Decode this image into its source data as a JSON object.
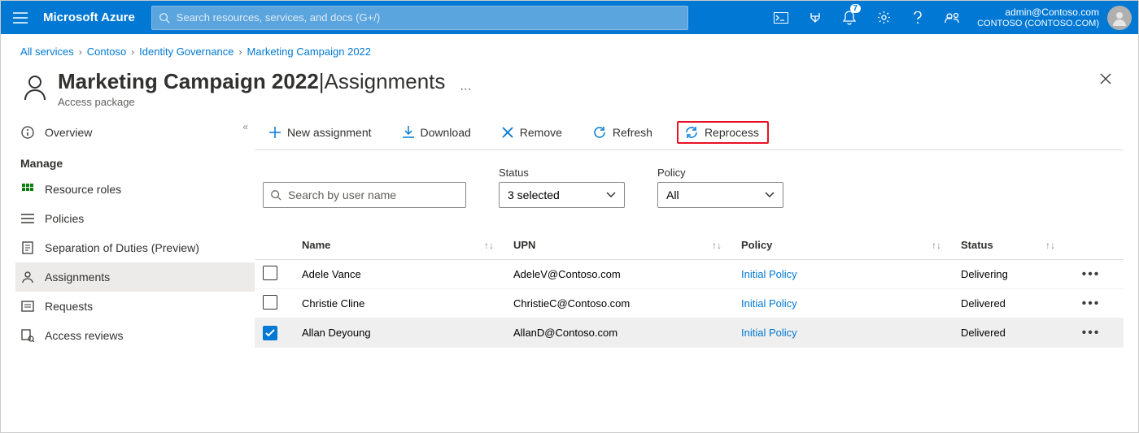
{
  "header": {
    "brand": "Microsoft Azure",
    "search_placeholder": "Search resources, services, and docs (G+/)",
    "notification_count": "7",
    "account_email": "admin@Contoso.com",
    "account_tenant": "CONTOSO (CONTOSO.COM)"
  },
  "breadcrumb": {
    "items": [
      "All services",
      "Contoso",
      "Identity Governance",
      "Marketing Campaign 2022"
    ]
  },
  "page": {
    "title_main": "Marketing Campaign 2022",
    "title_sep": " | ",
    "title_sub": "Assignments",
    "subtitle": "Access package"
  },
  "sidebar": {
    "overview": "Overview",
    "manage_heading": "Manage",
    "items": [
      {
        "label": "Resource roles"
      },
      {
        "label": "Policies"
      },
      {
        "label": "Separation of Duties (Preview)"
      },
      {
        "label": "Assignments"
      },
      {
        "label": "Requests"
      },
      {
        "label": "Access reviews"
      }
    ]
  },
  "toolbar": {
    "new_assignment": "New assignment",
    "download": "Download",
    "remove": "Remove",
    "refresh": "Refresh",
    "reprocess": "Reprocess"
  },
  "filters": {
    "search_placeholder": "Search by user name",
    "status_label": "Status",
    "status_value": "3 selected",
    "policy_label": "Policy",
    "policy_value": "All"
  },
  "table": {
    "headers": {
      "name": "Name",
      "upn": "UPN",
      "policy": "Policy",
      "status": "Status"
    },
    "rows": [
      {
        "name": "Adele Vance",
        "upn": "AdeleV@Contoso.com",
        "policy": "Initial Policy",
        "status": "Delivering",
        "selected": false
      },
      {
        "name": "Christie Cline",
        "upn": "ChristieC@Contoso.com",
        "policy": "Initial Policy",
        "status": "Delivered",
        "selected": false
      },
      {
        "name": "Allan Deyoung",
        "upn": "AllanD@Contoso.com",
        "policy": "Initial Policy",
        "status": "Delivered",
        "selected": true
      }
    ]
  }
}
